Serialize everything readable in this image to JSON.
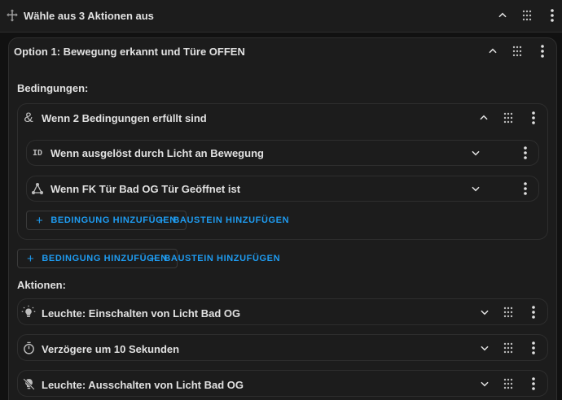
{
  "header": {
    "title": "Wähle aus 3 Aktionen aus",
    "icon": "arrows-split-icon"
  },
  "option": {
    "title": "Option 1: Bewegung erkannt und Türe OFFEN"
  },
  "conditions": {
    "label": "Bedingungen:",
    "group": {
      "title": "Wenn 2 Bedingungen erfüllt sind",
      "items": [
        {
          "label": "Wenn ausgelöst durch Licht an Bewegung",
          "icon": "id-icon"
        },
        {
          "label": "Wenn FK Tür Bad OG Tür Geöffnet ist",
          "icon": "network-icon"
        }
      ],
      "add_condition": "BEDINGUNG HINZUFÜGEN",
      "add_block": "BAUSTEIN HINZUFÜGEN"
    },
    "add_condition": "BEDINGUNG HINZUFÜGEN",
    "add_block": "BAUSTEIN HINZUFÜGEN"
  },
  "actions": {
    "label": "Aktionen:",
    "items": [
      {
        "label": "Leuchte: Einschalten von Licht Bad OG",
        "icon": "lightbulb-on-icon"
      },
      {
        "label": "Verzögere um 10 Sekunden",
        "icon": "timer-icon"
      },
      {
        "label": "Leuchte: Ausschalten von Licht Bad OG",
        "icon": "lightbulb-off-icon"
      }
    ]
  },
  "colors": {
    "accent": "#1e9bf0",
    "background": "#111111",
    "card": "#1c1c1c",
    "border": "#2e2e2e",
    "text": "#e1e1e1"
  }
}
